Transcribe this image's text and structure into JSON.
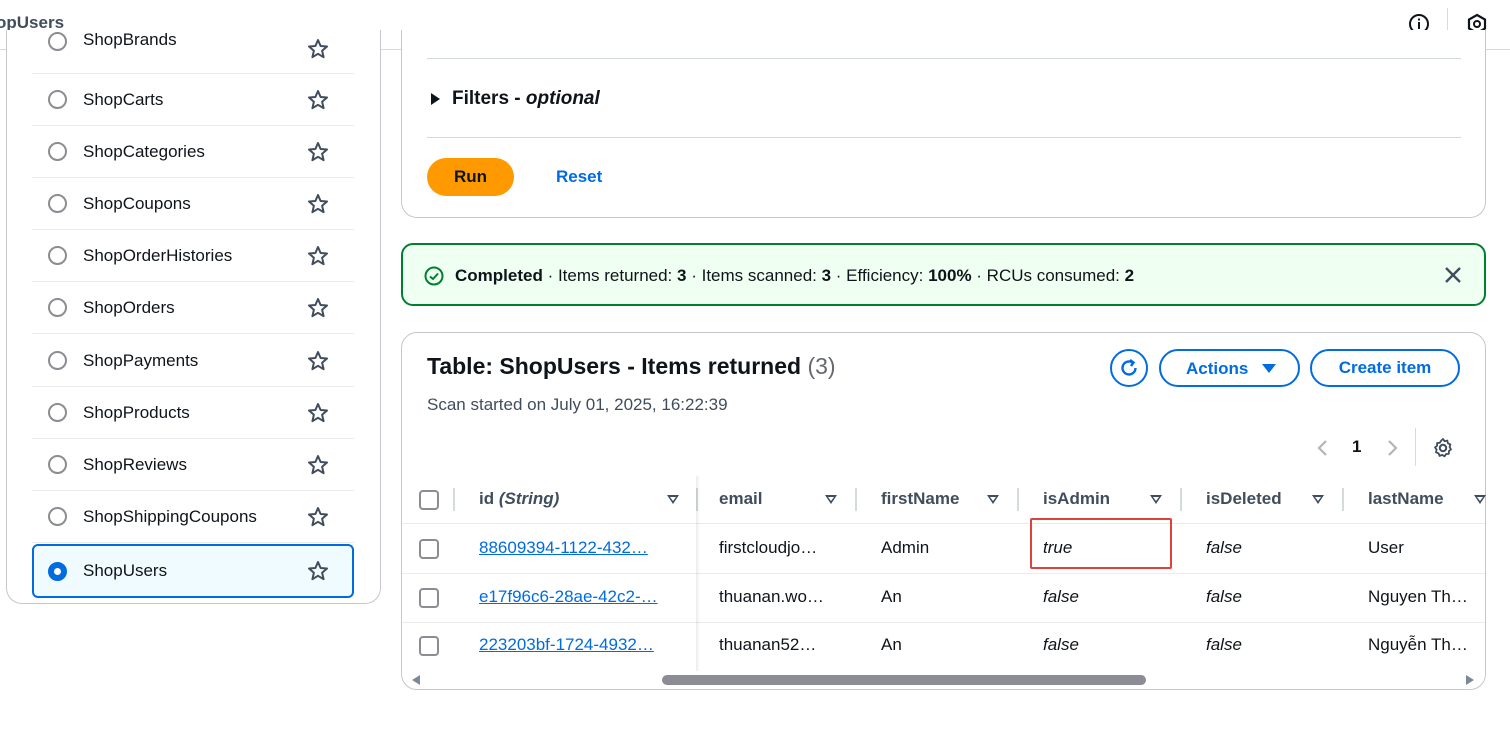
{
  "topbar": {
    "title": "opUsers",
    "info_icon": "info-icon",
    "settings_icon": "hexagon-settings-icon"
  },
  "sidebar": {
    "items": [
      {
        "label": "ShopBrands",
        "selected": false
      },
      {
        "label": "ShopCarts",
        "selected": false
      },
      {
        "label": "ShopCategories",
        "selected": false
      },
      {
        "label": "ShopCoupons",
        "selected": false
      },
      {
        "label": "ShopOrderHistories",
        "selected": false
      },
      {
        "label": "ShopOrders",
        "selected": false
      },
      {
        "label": "ShopPayments",
        "selected": false
      },
      {
        "label": "ShopProducts",
        "selected": false
      },
      {
        "label": "ShopReviews",
        "selected": false
      },
      {
        "label": "ShopShippingCoupons",
        "selected": false
      },
      {
        "label": "ShopUsers",
        "selected": true
      }
    ]
  },
  "query": {
    "filters_label": "Filters - ",
    "filters_optional": "optional",
    "run_label": "Run",
    "reset_label": "Reset"
  },
  "alert": {
    "status": "Completed",
    "items_returned_label": " · Items returned: ",
    "items_returned": "3",
    "items_scanned_label": " · Items scanned: ",
    "items_scanned": "3",
    "efficiency_label": " · Efficiency: ",
    "efficiency": "100%",
    "rcus_label": " · RCUs consumed: ",
    "rcus": "2"
  },
  "table": {
    "title": "Table: ShopUsers - Items returned",
    "count": "(3)",
    "subtitle": "Scan started on July 01, 2025, 16:22:39",
    "actions_label": "Actions",
    "create_label": "Create item",
    "page": "1",
    "columns": [
      {
        "name": "id",
        "type": "(String)"
      },
      {
        "name": "email"
      },
      {
        "name": "firstName"
      },
      {
        "name": "isAdmin"
      },
      {
        "name": "isDeleted"
      },
      {
        "name": "lastName"
      }
    ],
    "rows": [
      {
        "id": "88609394-1122-432…",
        "email": "firstcloudjo…",
        "firstName": "Admin",
        "isAdmin": "true",
        "isDeleted": "false",
        "lastName": "User"
      },
      {
        "id": "e17f96c6-28ae-42c2-…",
        "email": "thuanan.wo…",
        "firstName": "An",
        "isAdmin": "false",
        "isDeleted": "false",
        "lastName": "Nguyen Th…"
      },
      {
        "id": "223203bf-1724-4932…",
        "email": "thuanan52…",
        "firstName": "An",
        "isAdmin": "false",
        "isDeleted": "false",
        "lastName": "Nguyễn Th…"
      }
    ]
  },
  "colors": {
    "accent": "#006ce0",
    "run": "#ff9900",
    "success": "#00802f",
    "highlight": "#e0423a"
  }
}
